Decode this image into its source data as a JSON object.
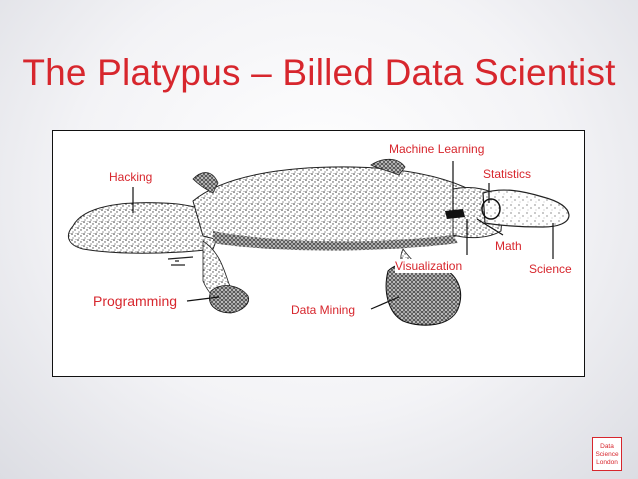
{
  "slide": {
    "title": "The Platypus – Billed Data Scientist"
  },
  "figure": {
    "labels": {
      "hacking": "Hacking",
      "machine_learning": "Machine Learning",
      "statistics": "Statistics",
      "math": "Math",
      "visualization": "Visualization",
      "science": "Science",
      "programming": "Programming",
      "data_mining": "Data Mining"
    }
  },
  "logo": {
    "line1": "Data",
    "line2": "Science",
    "line3": "London"
  },
  "colors": {
    "accent": "#d7262d",
    "ink": "#111111"
  }
}
